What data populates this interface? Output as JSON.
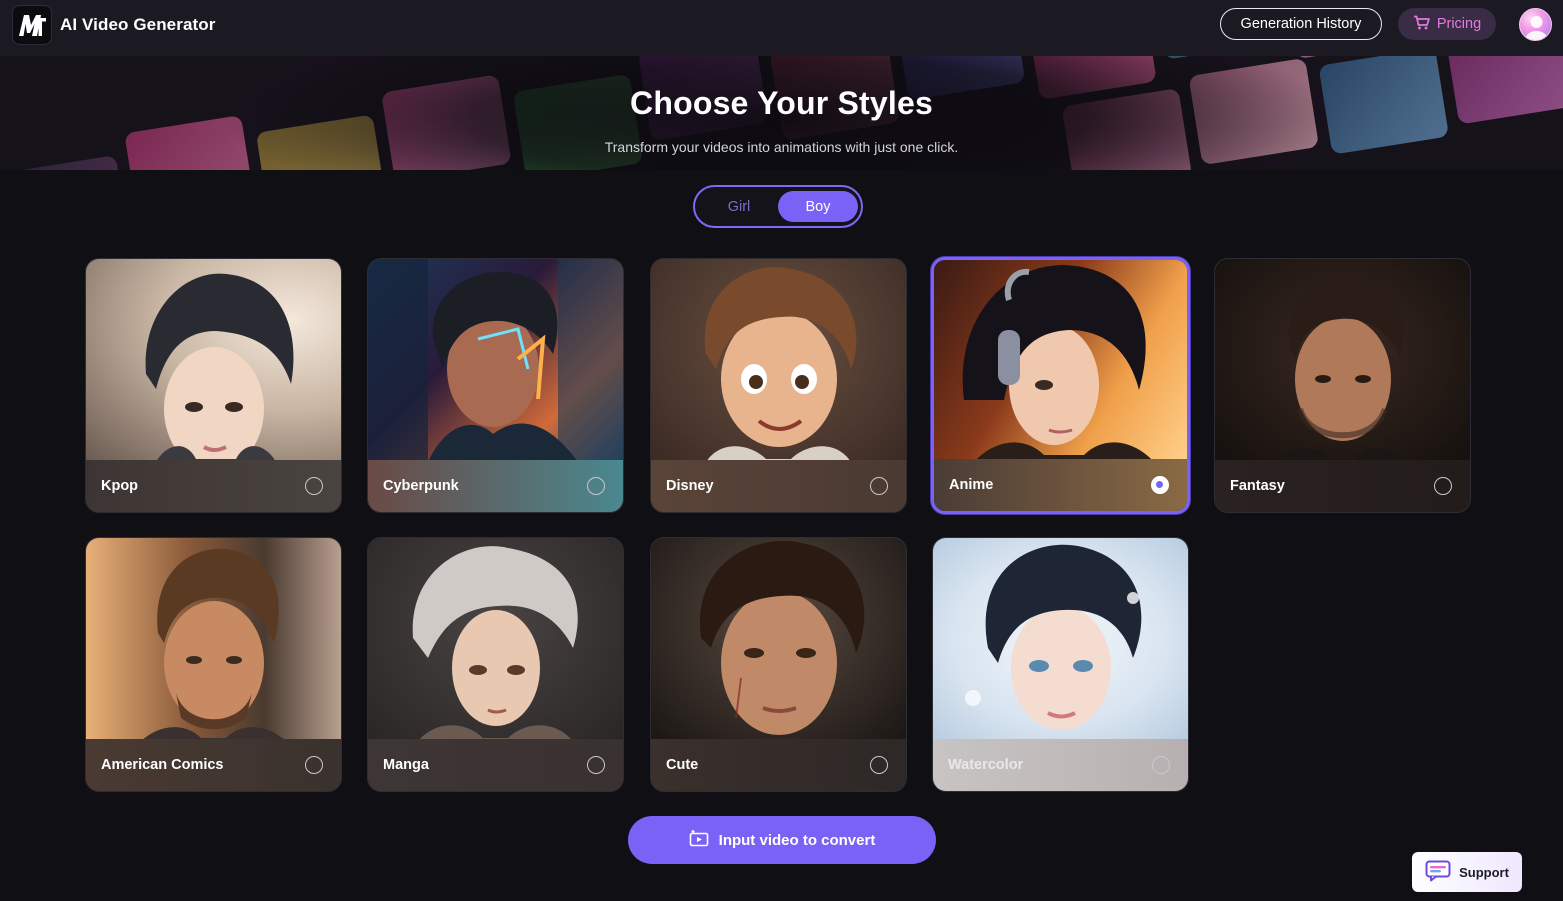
{
  "header": {
    "app_title": "AI Video Generator",
    "history_label": "Generation History",
    "pricing_label": "Pricing"
  },
  "hero": {
    "title": "Choose Your Styles",
    "subtitle": "Transform your videos into animations with just one click."
  },
  "gender_toggle": {
    "options": [
      "Girl",
      "Boy"
    ],
    "selected": "Boy"
  },
  "styles": [
    {
      "label": "Kpop",
      "selected": false
    },
    {
      "label": "Cyberpunk",
      "selected": false
    },
    {
      "label": "Disney",
      "selected": false
    },
    {
      "label": "Anime",
      "selected": true
    },
    {
      "label": "Fantasy",
      "selected": false
    },
    {
      "label": "American Comics",
      "selected": false
    },
    {
      "label": "Manga",
      "selected": false
    },
    {
      "label": "Cute",
      "selected": false
    },
    {
      "label": "Watercolor",
      "selected": false
    }
  ],
  "actions": {
    "convert_label": "Input video to convert",
    "support_label": "Support"
  },
  "colors": {
    "accent": "#7a62f6",
    "pricing_text": "#e27ce0",
    "background": "#101014"
  },
  "icons": [
    "logo-icon",
    "cart-icon",
    "video-upload-icon",
    "chat-support-icon"
  ]
}
